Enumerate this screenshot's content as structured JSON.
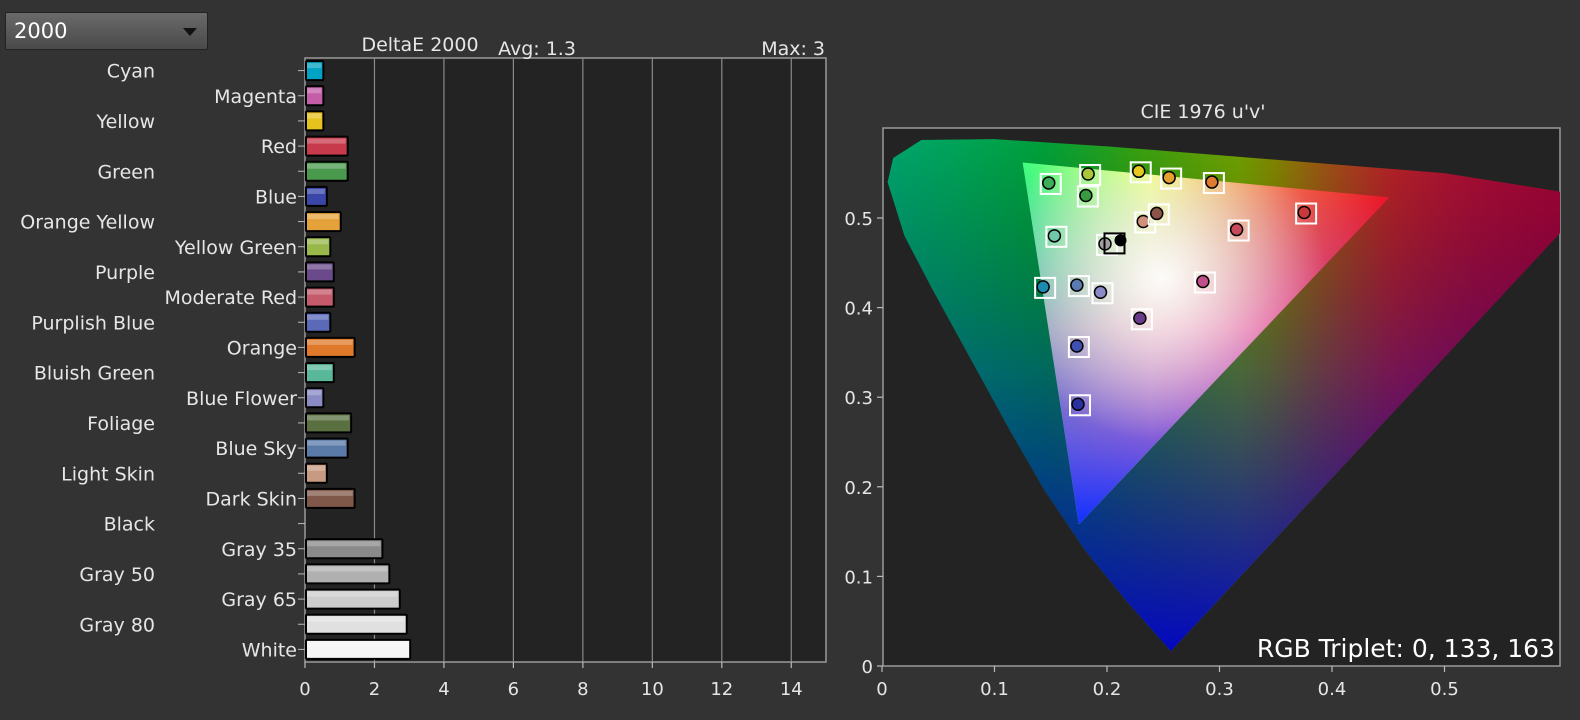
{
  "dropdown": {
    "value": "2000"
  },
  "colors": {
    "background": "#333333",
    "plot_background": "#232323",
    "gridline": "#8a8a8a"
  },
  "chart_data": [
    {
      "type": "bar",
      "orientation": "horizontal",
      "title": "DeltaE 2000",
      "avg_label": "Avg: 1.3",
      "max_label": "Max: 3",
      "xlim": [
        0,
        15
      ],
      "xticks": [
        0,
        2,
        4,
        6,
        8,
        10,
        12,
        14
      ],
      "grid": true,
      "categories": [
        "Cyan",
        "Magenta",
        "Yellow",
        "Red",
        "Green",
        "Blue",
        "Orange Yellow",
        "Yellow Green",
        "Purple",
        "Moderate Red",
        "Purplish Blue",
        "Orange",
        "Bluish Green",
        "Blue Flower",
        "Foliage",
        "Blue Sky",
        "Light Skin",
        "Dark Skin",
        "Black",
        "Gray 35",
        "Gray 50",
        "Gray 65",
        "Gray 80",
        "White"
      ],
      "values": [
        0.5,
        0.5,
        0.5,
        1.2,
        1.2,
        0.6,
        1.0,
        0.7,
        0.8,
        0.8,
        0.7,
        1.4,
        0.8,
        0.5,
        1.3,
        1.2,
        0.6,
        1.4,
        0.0,
        2.2,
        2.4,
        2.7,
        2.9,
        3.0
      ],
      "bar_colors": [
        "#00a3c4",
        "#c45ea8",
        "#e6c21e",
        "#c73a4b",
        "#4a9a4e",
        "#3a46a8",
        "#e6a23a",
        "#98b84a",
        "#6a4a8a",
        "#c45a6a",
        "#5a6ab8",
        "#e07a2a",
        "#5ab89a",
        "#8a8ac4",
        "#5a7040",
        "#5a7aa8",
        "#c89a82",
        "#80584a",
        "#101010",
        "#8a8a8a",
        "#b0b0b0",
        "#cccccc",
        "#e0e0e0",
        "#f5f5f5"
      ]
    },
    {
      "type": "scatter",
      "title": "CIE 1976 u'v'",
      "xlim": [
        0,
        0.6
      ],
      "ylim": [
        0,
        0.6
      ],
      "xticks": [
        0,
        0.1,
        0.2,
        0.3,
        0.4,
        0.5
      ],
      "yticks": [
        0,
        0.1,
        0.2,
        0.3,
        0.4,
        0.5
      ],
      "gamut_triangle": [
        [
          0.125,
          0.562
        ],
        [
          0.451,
          0.523
        ],
        [
          0.175,
          0.158
        ]
      ],
      "white_point": [
        0.212,
        0.475
      ],
      "points": [
        {
          "u": 0.15,
          "v": 0.538,
          "color": "#3fae5a"
        },
        {
          "u": 0.185,
          "v": 0.548,
          "color": "#a8c83a"
        },
        {
          "u": 0.23,
          "v": 0.551,
          "color": "#e6c820"
        },
        {
          "u": 0.257,
          "v": 0.544,
          "color": "#e6a030"
        },
        {
          "u": 0.295,
          "v": 0.539,
          "color": "#e07a30"
        },
        {
          "u": 0.183,
          "v": 0.524,
          "color": "#3a9a40"
        },
        {
          "u": 0.234,
          "v": 0.495,
          "color": "#d0907a"
        },
        {
          "u": 0.246,
          "v": 0.504,
          "color": "#8a5548"
        },
        {
          "u": 0.377,
          "v": 0.505,
          "color": "#c83a3a"
        },
        {
          "u": 0.155,
          "v": 0.479,
          "color": "#70c8a8"
        },
        {
          "u": 0.2,
          "v": 0.47,
          "color": "#a0a0a0"
        },
        {
          "u": 0.317,
          "v": 0.486,
          "color": "#c84a5a"
        },
        {
          "u": 0.145,
          "v": 0.422,
          "color": "#1a8ab0"
        },
        {
          "u": 0.175,
          "v": 0.424,
          "color": "#5a7ab0"
        },
        {
          "u": 0.196,
          "v": 0.416,
          "color": "#8a8ac8"
        },
        {
          "u": 0.287,
          "v": 0.428,
          "color": "#c0508a"
        },
        {
          "u": 0.231,
          "v": 0.387,
          "color": "#6a3a8a"
        },
        {
          "u": 0.175,
          "v": 0.356,
          "color": "#4050b0"
        },
        {
          "u": 0.176,
          "v": 0.291,
          "color": "#2a30a0"
        }
      ],
      "annotation": "RGB Triplet: 0, 133, 163"
    }
  ]
}
